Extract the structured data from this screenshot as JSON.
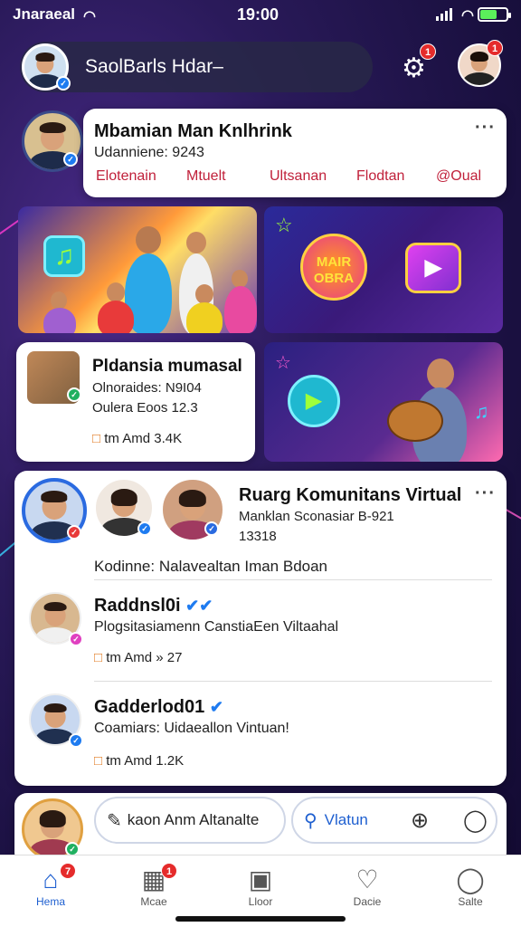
{
  "status": {
    "carrier": "Jnaraeal",
    "time": "19:00"
  },
  "search": {
    "placeholder": "SaolBarls Hdar–"
  },
  "header": {
    "settings_badge": "1",
    "profile_badge": "1"
  },
  "top_card": {
    "name": "Mbamian Man Knlhrink",
    "subtitle": "Udanniene: 9243",
    "links": [
      "Elotenain",
      "Mtuelt",
      "Ultsanan",
      "Flodtan",
      "@Oual"
    ]
  },
  "tile_game": {
    "logo_text_line1": "MAIR",
    "logo_text_line2": "OBRA"
  },
  "small_card": {
    "title": "Pldansia mumasal",
    "line1": "Olnoraides: N9I04",
    "line2": "Oulera Eoos  12.3",
    "stat": "tm Amd 3.4K"
  },
  "community": {
    "title": "Ruarg Komunitans Virtual",
    "line1": "Manklan Sconasiar B-921",
    "line2": "13318",
    "caption": "Kodinne:  Nalavealtan Iman Bdoan",
    "posts": [
      {
        "name": "Raddnsl0i",
        "text": "Plogsitasiamenn CanstiaEen Viltaahal",
        "stat": "tm Amd  »  27"
      },
      {
        "name": "Gadderlod01",
        "text": "Coamiars: Uidaeallon Vintuan!",
        "stat": "tm Amd 1.2K"
      }
    ]
  },
  "composer": {
    "button1": "kaon Anm Altanalte",
    "button2": "Vlatun"
  },
  "nav": [
    {
      "label": "Hema",
      "badge": "7"
    },
    {
      "label": "Mcae",
      "badge": "1"
    },
    {
      "label": "Lloor"
    },
    {
      "label": "Dacie"
    },
    {
      "label": "Salte"
    }
  ],
  "colors": {
    "accent": "#1e7bf0",
    "link": "#c0203a",
    "badge": "#e52b2b",
    "nav_active": "#1e5fd0"
  },
  "icons": [
    "wifi-icon",
    "signal-icon",
    "battery-icon",
    "gear-icon",
    "verified-icon",
    "more-icon",
    "music-icon",
    "play-icon",
    "chat-icon",
    "comment-icon",
    "plus-icon",
    "home-icon",
    "video-icon",
    "store-icon",
    "notifications-icon",
    "profile-icon"
  ]
}
